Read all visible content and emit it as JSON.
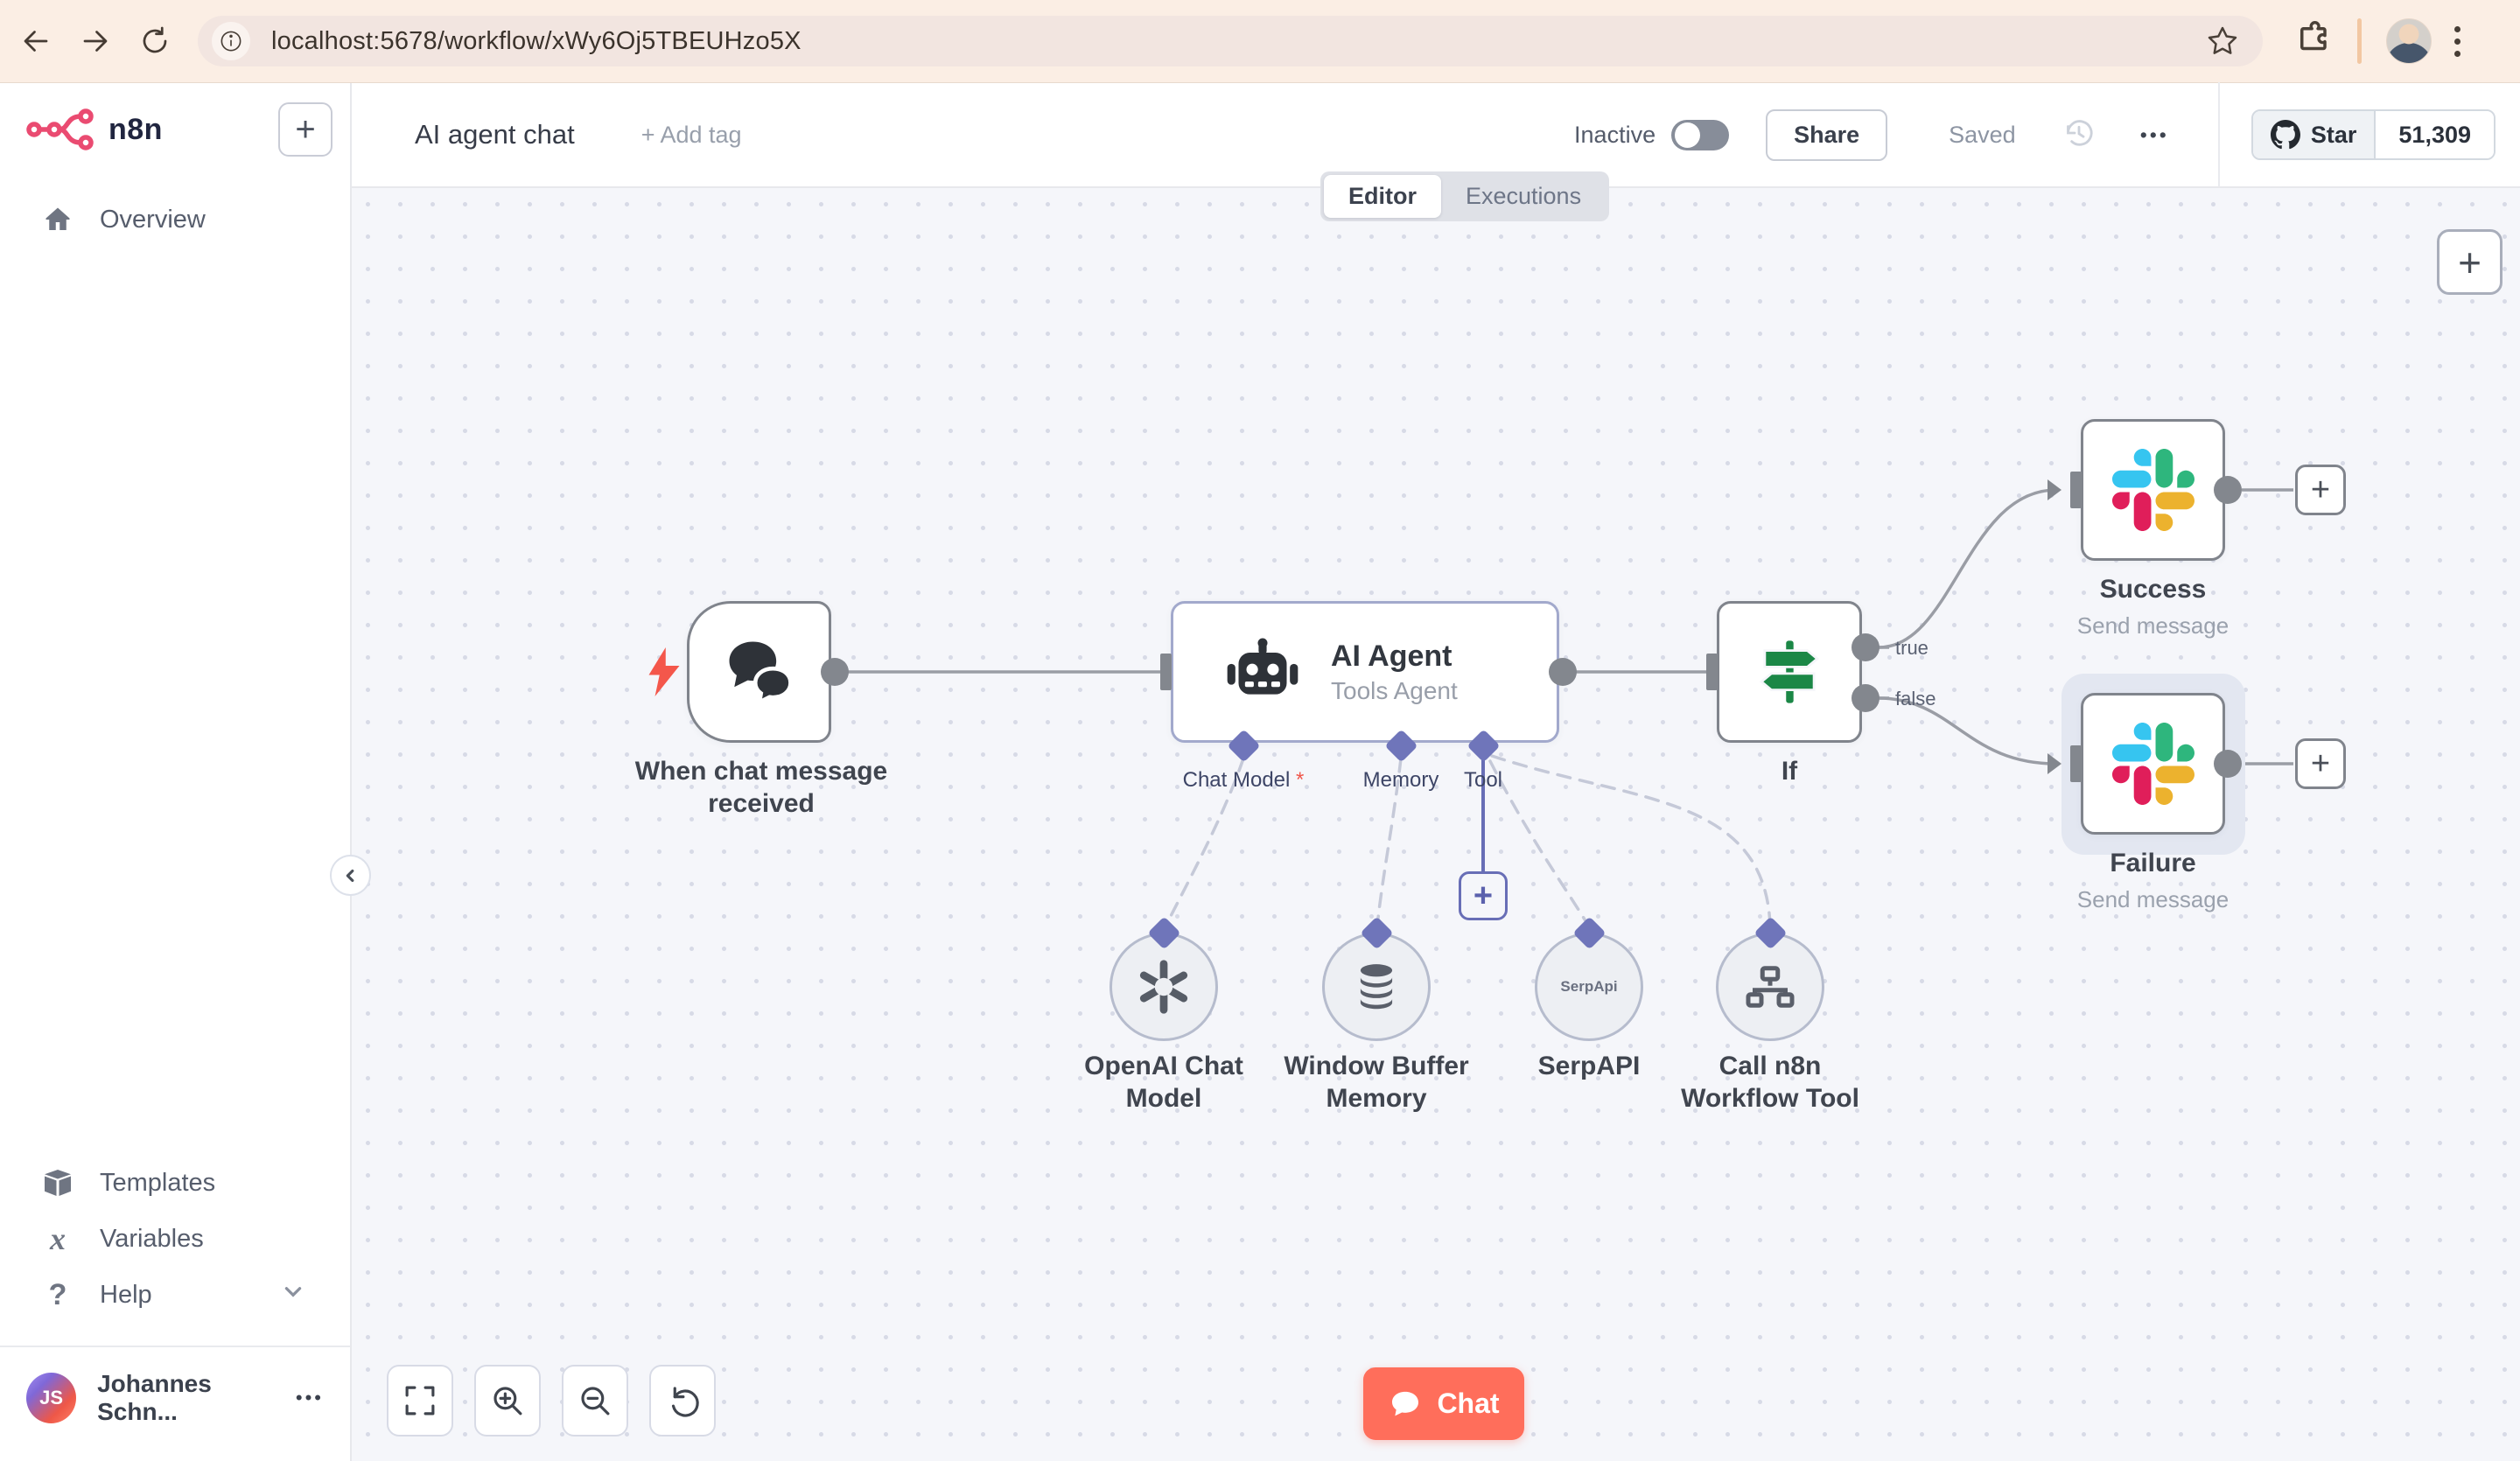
{
  "browser": {
    "url": "localhost:5678/workflow/xWy6Oj5TBEUHzo5X"
  },
  "sidebar": {
    "logo_text": "n8n",
    "overview": "Overview",
    "templates": "Templates",
    "variables": "Variables",
    "help": "Help",
    "user": {
      "initials": "JS",
      "name": "Johannes Schn...",
      "menu": "•••"
    }
  },
  "header": {
    "title": "AI agent chat",
    "add_tag": "+ Add tag",
    "activation_label": "Inactive",
    "share": "Share",
    "saved": "Saved",
    "more": "•••",
    "github": {
      "star_label": "Star",
      "star_count": "51,309"
    }
  },
  "tabs": {
    "editor": "Editor",
    "executions": "Executions",
    "active": "Editor"
  },
  "workflow": {
    "trigger": {
      "label": "When chat message received"
    },
    "agent": {
      "title": "AI Agent",
      "subtitle": "Tools Agent",
      "inputs": [
        {
          "label": "Chat Model",
          "required": "*"
        },
        {
          "label": "Memory",
          "required": ""
        },
        {
          "label": "Tool",
          "required": ""
        }
      ]
    },
    "if": {
      "label": "If",
      "outputs": [
        "true",
        "false"
      ]
    },
    "success": {
      "label": "Success",
      "subtitle": "Send message"
    },
    "failure": {
      "label": "Failure",
      "subtitle": "Send message"
    },
    "subnodes": [
      {
        "label": "OpenAI Chat Model"
      },
      {
        "label": "Window Buffer Memory"
      },
      {
        "label": "SerpAPI",
        "badge": "SerpApi"
      },
      {
        "label": "Call n8n Workflow Tool"
      }
    ]
  },
  "canvas": {
    "plus": "+",
    "chat_button": "Chat"
  },
  "colors": {
    "accent": "#ea4b71",
    "chat_button": "#ff6e5b",
    "node_border": "#80848c",
    "agent_border": "#a2a9cc",
    "port": "#83878e",
    "diamond": "#6f75ba",
    "if_green": "#1b8746",
    "slack_blue": "#36c5f0",
    "slack_green": "#2eb67d",
    "slack_yellow": "#ecb22e",
    "slack_red": "#e01e5a"
  }
}
